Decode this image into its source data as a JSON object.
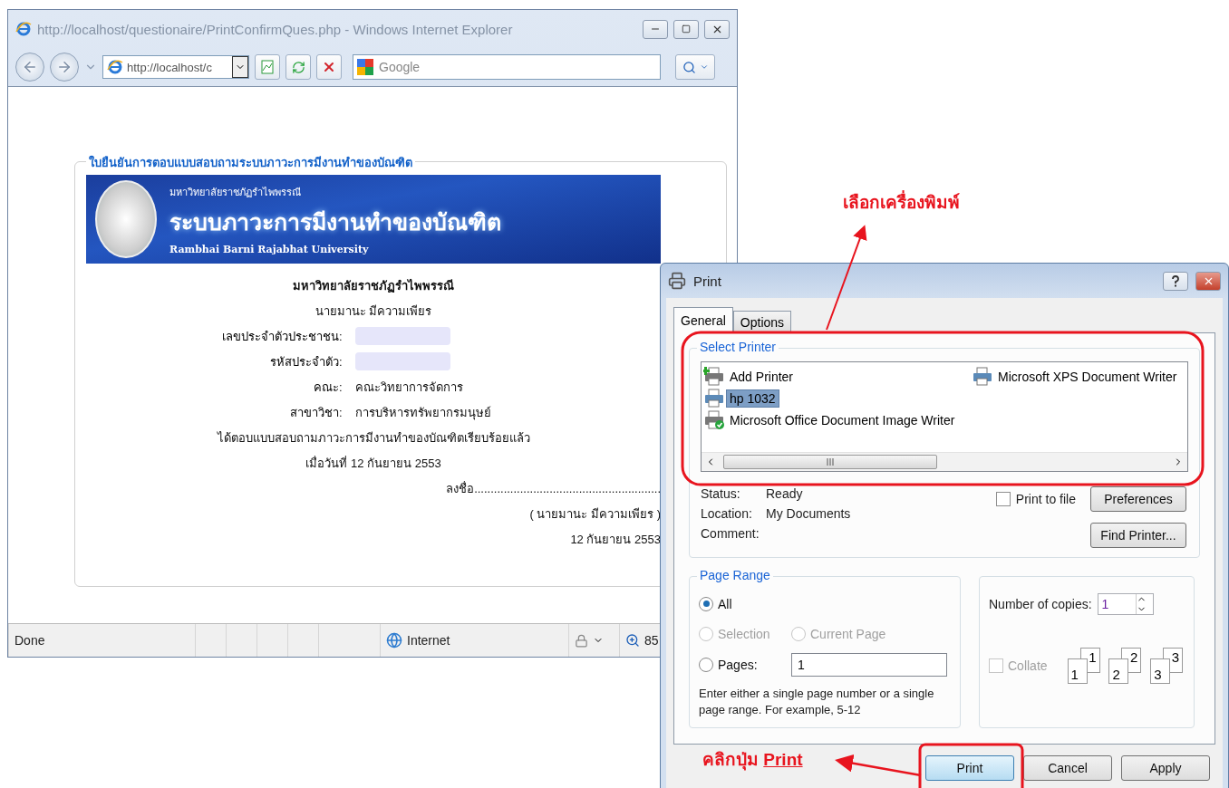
{
  "browser": {
    "title": "http://localhost/questionaire/PrintConfirmQues.php - Windows Internet Explorer",
    "address": "http://localhost/c",
    "search_placeholder": "Google",
    "status": "Done",
    "zone": "Internet",
    "zoom": "85"
  },
  "page": {
    "legend": "ใบยืนยันการตอบแบบสอบถามระบบภาวะการมีงานทำของบัณฑิต",
    "banner": {
      "university": "มหาวิทยาลัยราชภัฏรำไพพรรณี",
      "system": "ระบบภาวะการมีงานทำของบัณฑิต",
      "english": "Rambhai Barni Rajabhat University"
    },
    "heading": "มหาวิทยาลัยราชภัฏรำไพพรรณี",
    "name": "นายมานะ มีความเพียร",
    "fields": [
      {
        "label": "เลขประจำตัวประชาชน",
        "colon": ":",
        "kind": "masked"
      },
      {
        "label": "รหัสประจำตัว",
        "colon": ":",
        "kind": "masked"
      },
      {
        "label": "คณะ",
        "colon": ":",
        "kind": "text",
        "value": "คณะวิทยาการจัดการ"
      },
      {
        "label": "สาขาวิชา",
        "colon": ":",
        "kind": "text",
        "value": "การบริหารทรัพยากรมนุษย์"
      }
    ],
    "statement": "ได้ตอบแบบสอบถามภาวะการมีงานทำของบัณฑิตเรียบร้อยแล้ว",
    "date_line": "เมื่อวันที่  12 กันยายน 2553",
    "signature": "ลงชื่อ.........................................................",
    "signer": "( นายมานะ  มีความเพียร )",
    "signed_date": "12 กันยายน 2553"
  },
  "dialog": {
    "title": "Print",
    "tabs": [
      {
        "label": "General",
        "selected": true
      },
      {
        "label": "Options",
        "selected": false
      }
    ],
    "select_printer": {
      "legend": "Select Printer",
      "printers": [
        {
          "name": "Add Printer",
          "kind": "add",
          "selected": false
        },
        {
          "name": "hp 1032",
          "kind": "printer",
          "selected": true
        },
        {
          "name": "Microsoft Office Document Image Writer",
          "kind": "default",
          "selected": false
        },
        {
          "name": "Microsoft XPS Document Writer",
          "kind": "printer",
          "selected": false
        }
      ]
    },
    "info": [
      {
        "label": "Status:",
        "value": "Ready"
      },
      {
        "label": "Location:",
        "value": "My Documents"
      },
      {
        "label": "Comment:"
      }
    ],
    "print_to_file": {
      "label": "Print to file",
      "checked": false
    },
    "side_buttons": [
      "Preferences",
      "Find Printer..."
    ],
    "page_range": {
      "legend": "Page Range",
      "rows": [
        [
          {
            "label": "All",
            "selected": true,
            "disabled": false
          }
        ],
        [
          {
            "label": "Selection",
            "selected": false,
            "disabled": true
          },
          {
            "label": "Current Page",
            "selected": false,
            "disabled": true
          }
        ],
        [
          {
            "label": "Pages:",
            "selected": false,
            "disabled": false
          }
        ]
      ],
      "pages_value": "1",
      "hint": "Enter either a single page number or a single page range.  For example, 5-12"
    },
    "copies": {
      "label": "Number of copies:",
      "value": "1",
      "collate": {
        "label": "Collate",
        "checked": false,
        "disabled": true
      },
      "pairs": [
        {
          "front": "1",
          "back": "1"
        },
        {
          "front": "2",
          "back": "2"
        },
        {
          "front": "3",
          "back": "3"
        }
      ]
    },
    "buttons": [
      {
        "label": "Print",
        "focused": true
      },
      {
        "label": "Cancel",
        "focused": false
      },
      {
        "label": "Apply",
        "focused": false
      }
    ]
  },
  "annotations": [
    {
      "text": "เลือกเครื่องพิมพ์"
    },
    {
      "lead": "คลิกปุ่ม ",
      "key": "Print"
    }
  ]
}
